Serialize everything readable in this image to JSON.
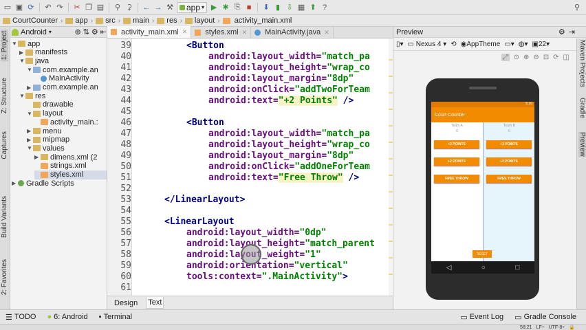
{
  "toolbar": {
    "run_config": "app"
  },
  "breadcrumb": [
    "CourtCounter",
    "app",
    "src",
    "main",
    "res",
    "layout",
    "activity_main.xml"
  ],
  "left_strip": {
    "tabs": [
      "1: Project",
      "Z: Structure",
      "Captures",
      "Build Variants",
      "2: Favorites"
    ]
  },
  "project": {
    "view_label": "Android",
    "tree": [
      {
        "label": "app",
        "depth": 0,
        "icon": "folder",
        "open": true
      },
      {
        "label": "manifests",
        "depth": 1,
        "icon": "folder",
        "open": false
      },
      {
        "label": "java",
        "depth": 1,
        "icon": "folder",
        "open": true
      },
      {
        "label": "com.example.an",
        "depth": 2,
        "icon": "package",
        "open": true
      },
      {
        "label": "MainActivity",
        "depth": 3,
        "icon": "class"
      },
      {
        "label": "com.example.an",
        "depth": 2,
        "icon": "package",
        "open": false
      },
      {
        "label": "res",
        "depth": 1,
        "icon": "folder",
        "open": true
      },
      {
        "label": "drawable",
        "depth": 2,
        "icon": "folder"
      },
      {
        "label": "layout",
        "depth": 2,
        "icon": "folder",
        "open": true
      },
      {
        "label": "activity_main.:",
        "depth": 3,
        "icon": "xml"
      },
      {
        "label": "menu",
        "depth": 2,
        "icon": "folder",
        "open": false
      },
      {
        "label": "mipmap",
        "depth": 2,
        "icon": "folder",
        "open": false
      },
      {
        "label": "values",
        "depth": 2,
        "icon": "folder",
        "open": true
      },
      {
        "label": "dimens.xml (2",
        "depth": 3,
        "icon": "folder",
        "open": false
      },
      {
        "label": "strings.xml",
        "depth": 3,
        "icon": "xml"
      },
      {
        "label": "styles.xml",
        "depth": 3,
        "icon": "xml",
        "selected": true
      },
      {
        "label": "Gradle Scripts",
        "depth": 0,
        "icon": "gradle",
        "open": false
      }
    ]
  },
  "editor_tabs": [
    {
      "label": "activity_main.xml",
      "active": true,
      "icon": "xml"
    },
    {
      "label": "styles.xml",
      "active": false,
      "icon": "xml"
    },
    {
      "label": "MainActivity.java",
      "active": false,
      "icon": "class"
    }
  ],
  "code": {
    "line_numbers": [
      "39",
      "40",
      "41",
      "42",
      "43",
      "44",
      "45",
      "46",
      "47",
      "48",
      "49",
      "50",
      "51",
      "52",
      "53",
      "54",
      "55",
      "56",
      "57",
      "58",
      "59",
      "60",
      "61"
    ],
    "lines": [
      {
        "indent": 3,
        "tag": "<Button"
      },
      {
        "indent": 4,
        "attr": "android:layout_width=",
        "value": "\"match_pa"
      },
      {
        "indent": 4,
        "attr": "android:layout_height=",
        "value": "\"wrap_co"
      },
      {
        "indent": 4,
        "attr": "android:layout_margin=",
        "value": "\"8dp\""
      },
      {
        "indent": 4,
        "attr": "android:onClick=",
        "value": "\"addTwoForTeam"
      },
      {
        "indent": 4,
        "attr": "android:text=",
        "value": "\"+2 Points\"",
        "tail": " />",
        "hl": true
      },
      {
        "indent": 0
      },
      {
        "indent": 3,
        "tag": "<Button"
      },
      {
        "indent": 4,
        "attr": "android:layout_width=",
        "value": "\"match_pa"
      },
      {
        "indent": 4,
        "attr": "android:layout_height=",
        "value": "\"wrap_co"
      },
      {
        "indent": 4,
        "attr": "android:layout_margin=",
        "value": "\"8dp\""
      },
      {
        "indent": 4,
        "attr": "android:onClick=",
        "value": "\"addOneForTeam"
      },
      {
        "indent": 4,
        "attr": "android:text=",
        "value": "\"Free Throw\"",
        "tail": " />",
        "hl": true
      },
      {
        "indent": 0
      },
      {
        "indent": 2,
        "tag": "</LinearLayout>"
      },
      {
        "indent": 0
      },
      {
        "indent": 2,
        "tag": "<LinearLayout"
      },
      {
        "indent": 3,
        "attr": "android:layout_width=",
        "value": "\"0dp\""
      },
      {
        "indent": 3,
        "attr": "android:layout_height=",
        "value": "\"match_parent"
      },
      {
        "indent": 3,
        "attr": "android:layout_weight=",
        "value": "\"1\""
      },
      {
        "indent": 3,
        "attr": "android:orientation=",
        "value": "\"vertical\""
      },
      {
        "indent": 3,
        "attr": "tools:context=",
        "value": "\".MainActivity\"",
        "tail": ">"
      }
    ]
  },
  "design_tabs": {
    "design": "Design",
    "text": "Text"
  },
  "preview": {
    "title": "Preview",
    "device": "Nexus 4",
    "theme": "AppTheme",
    "api": "22",
    "right_strip": [
      "Maven Projects",
      "Gradle",
      "Preview"
    ],
    "phone": {
      "time": "5:10",
      "app_title": "Court Counter",
      "team_a": "Team A",
      "team_b": "Team B",
      "score_a": "0",
      "score_b": "0",
      "btn3": "+3 POINTS",
      "btn2": "+2 POINTS",
      "btnft": "FREE THROW",
      "reset": "RESET"
    }
  },
  "bottom": {
    "todo": "TODO",
    "android": "6: Android",
    "terminal": "Terminal",
    "event_log": "Event Log",
    "gradle_console": "Gradle Console"
  },
  "status_bar": {
    "position": "58:21",
    "line_sep": "LF÷",
    "encoding": "UTF-8÷"
  },
  "colors": {
    "accent": "#f28b00",
    "tag": "#000080",
    "attr": "#660e7a",
    "string": "#008000"
  }
}
